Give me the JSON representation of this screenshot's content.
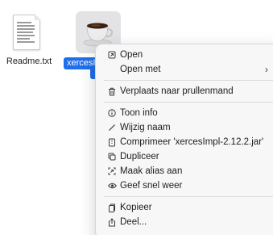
{
  "desktop": {
    "files": [
      {
        "name": "Readme.txt"
      },
      {
        "name": "xercesImpl-2.12.2.jar",
        "visible_label": "xercesIm"
      }
    ]
  },
  "context_menu": {
    "items": [
      {
        "label": "Open",
        "icon": "open-icon"
      },
      {
        "label": "Open met",
        "icon": "",
        "submenu": true
      },
      {
        "label": "Verplaats naar prullenmand",
        "icon": "trash-icon"
      },
      {
        "label": "Toon info",
        "icon": "info-icon"
      },
      {
        "label": "Wijzig naam",
        "icon": "pencil-icon"
      },
      {
        "label": "Comprimeer 'xercesImpl-2.12.2.jar'",
        "icon": "archive-icon"
      },
      {
        "label": "Dupliceer",
        "icon": "duplicate-icon"
      },
      {
        "label": "Maak alias aan",
        "icon": "alias-icon"
      },
      {
        "label": "Geef snel weer",
        "icon": "eye-icon"
      },
      {
        "label": "Kopieer",
        "icon": "copy-icon"
      },
      {
        "label": "Deel...",
        "icon": "share-icon"
      }
    ],
    "submenu_chevron": "›"
  },
  "colors": {
    "selection": "#1f6feb",
    "menu_bg": "#f7f7f7"
  }
}
